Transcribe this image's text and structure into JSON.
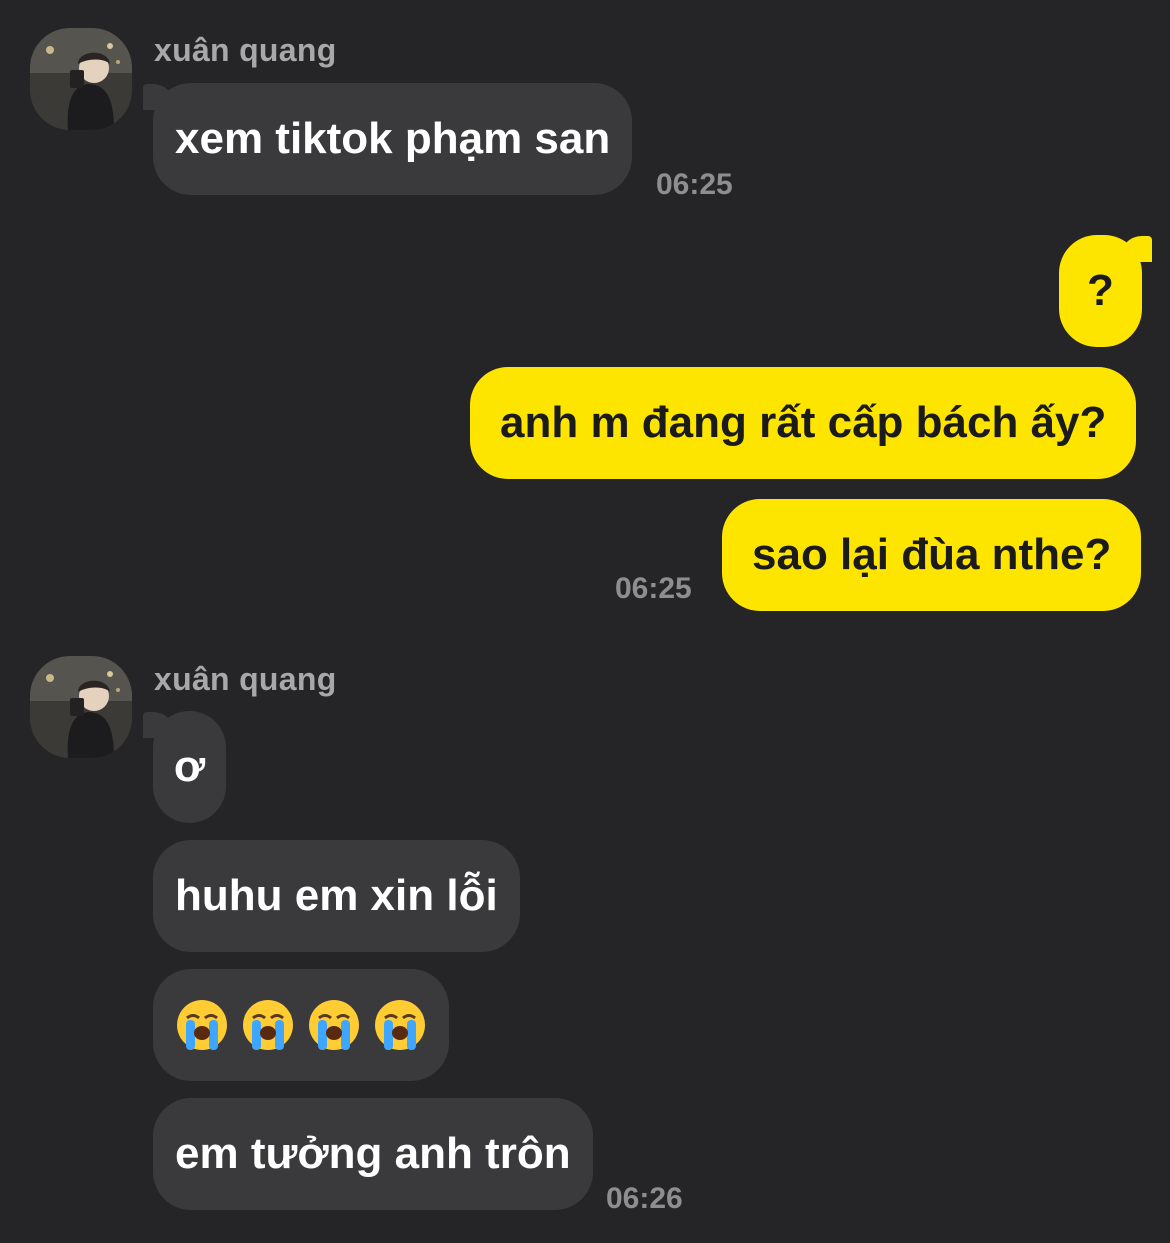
{
  "messages": {
    "group1": {
      "sender": "xuân quang",
      "bubble1": "xem tiktok phạm san",
      "time": "06:25"
    },
    "group2": {
      "bubble1": "?",
      "bubble2": "anh m đang rất cấp bách ấy?",
      "bubble3": "sao lại đùa nthe?",
      "time": "06:25"
    },
    "group3": {
      "sender": "xuân quang",
      "bubble1": "ơ",
      "bubble2": "huhu em xin lỗi",
      "bubble3_emojis": [
        "loudly-crying-face",
        "loudly-crying-face",
        "loudly-crying-face",
        "loudly-crying-face"
      ],
      "bubble4": "em tưởng anh trôn",
      "time": "06:26"
    }
  },
  "colors": {
    "background": "#252527",
    "incoming_bubble": "#3a3a3c",
    "outgoing_bubble": "#fee500"
  },
  "icons": {
    "avatar": "user-profile-photo",
    "emoji": "loudly-crying-face"
  }
}
